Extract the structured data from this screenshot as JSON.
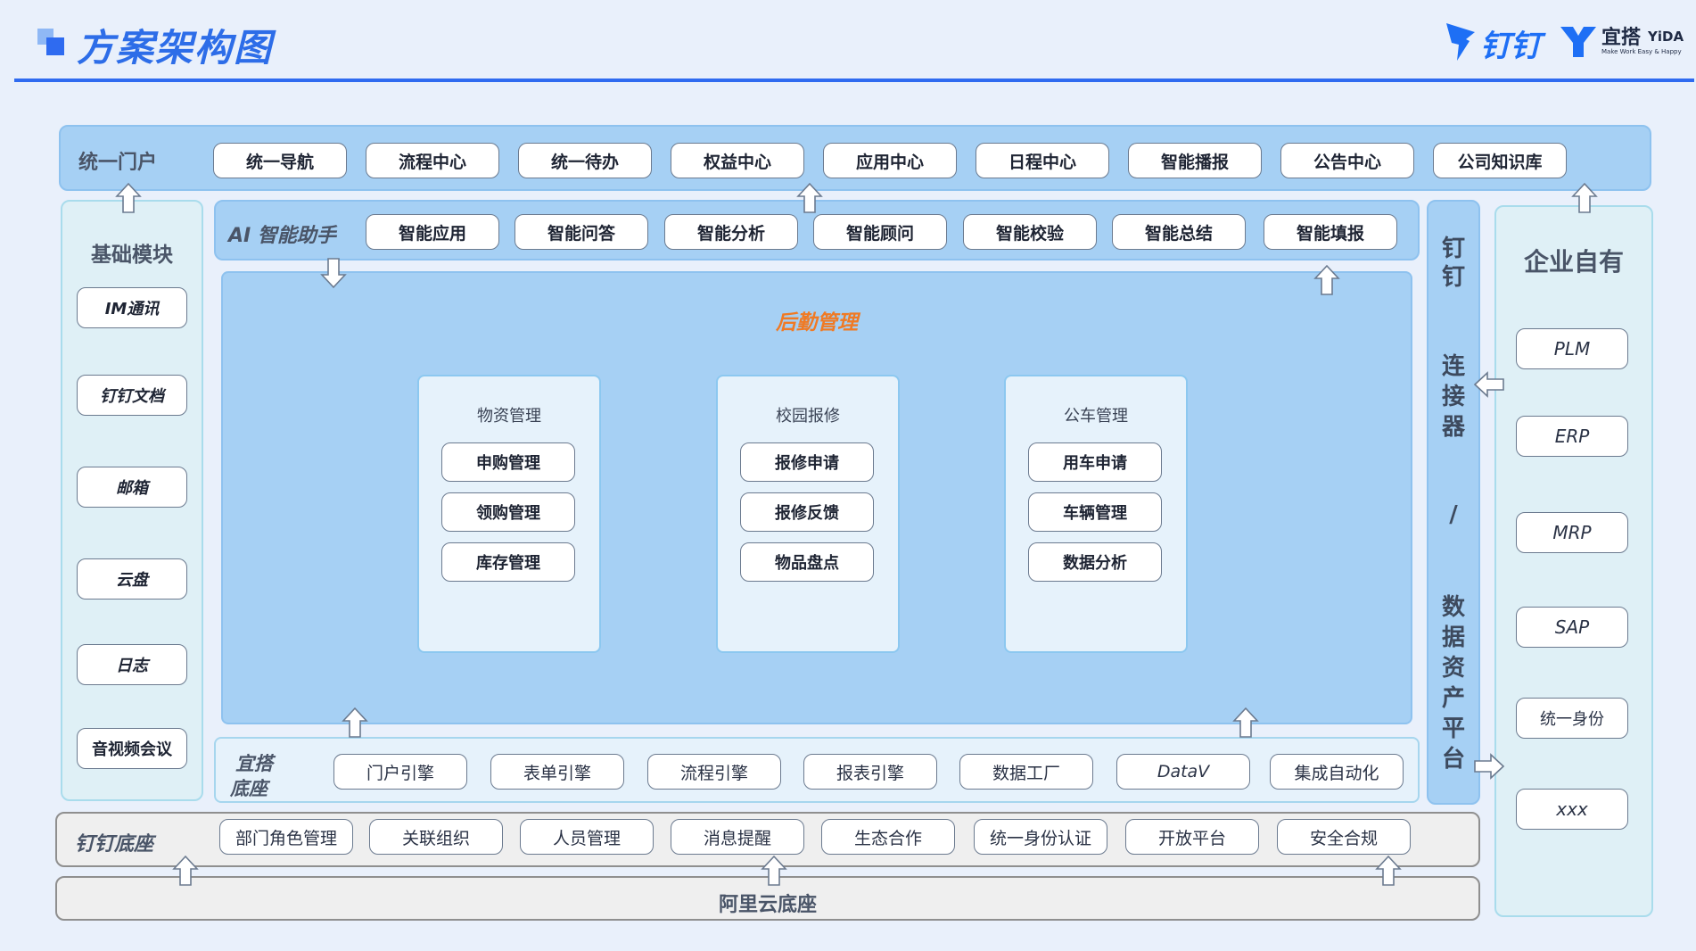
{
  "header": {
    "title": "方案架构图",
    "dingtalk_logo": "钉钉",
    "yida_logo_cn": "宜搭",
    "yida_logo_en": "YiDA",
    "yida_slogan": "Make Work Easy & Happy"
  },
  "portal": {
    "label": "统一门户",
    "items": [
      "统一导航",
      "流程中心",
      "统一待办",
      "权益中心",
      "应用中心",
      "日程中心",
      "智能播报",
      "公告中心",
      "公司知识库"
    ]
  },
  "base_modules": {
    "label": "基础模块",
    "items": [
      "IM通讯",
      "钉钉文档",
      "邮箱",
      "云盘",
      "日志",
      "音视频会议"
    ]
  },
  "ai": {
    "label": "AI 智能助手",
    "items": [
      "智能应用",
      "智能问答",
      "智能分析",
      "智能顾问",
      "智能校验",
      "智能总结",
      "智能填报"
    ]
  },
  "logistics": {
    "title": "后勤管理",
    "groups": [
      {
        "title": "物资管理",
        "items": [
          "申购管理",
          "领购管理",
          "库存管理"
        ]
      },
      {
        "title": "校园报修",
        "items": [
          "报修申请",
          "报修反馈",
          "物品盘点"
        ]
      },
      {
        "title": "公车管理",
        "items": [
          "用车申请",
          "车辆管理",
          "数据分析"
        ]
      }
    ]
  },
  "yida_base": {
    "label_line1": "宜搭",
    "label_line2": "底座",
    "items": [
      "门户引擎",
      "表单引擎",
      "流程引擎",
      "报表引擎",
      "数据工厂",
      "DataV",
      "集成自动化"
    ]
  },
  "connector": {
    "chars": [
      "钉",
      "钉",
      "连",
      "接",
      "器",
      "/",
      "数",
      "据",
      "资",
      "产",
      "平",
      "台"
    ]
  },
  "enterprise": {
    "label": "企业自有",
    "items": [
      "PLM",
      "ERP",
      "MRP",
      "SAP",
      "统一身份",
      "xxx"
    ]
  },
  "dingtalk_base": {
    "label": "钉钉底座",
    "items": [
      "部门角色管理",
      "关联组织",
      "人员管理",
      "消息提醒",
      "生态合作",
      "统一身份认证",
      "开放平台",
      "安全合规"
    ]
  },
  "aliyun": {
    "label": "阿里云底座"
  }
}
